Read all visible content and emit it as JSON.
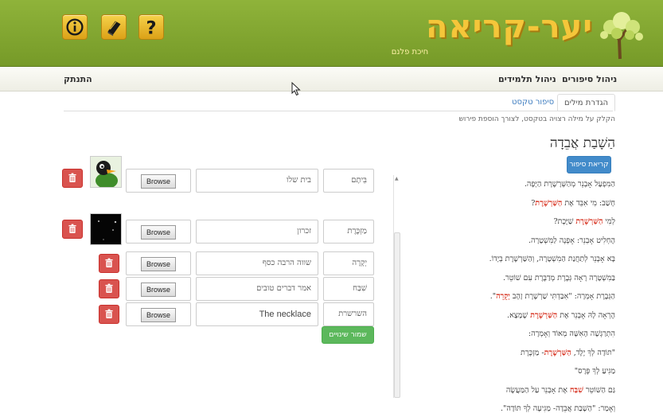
{
  "header": {
    "logo_title": "יער-קריאה",
    "logo_subtitle": "חיכת פלנם",
    "icons": [
      "info-icon",
      "book-icon",
      "help-icon"
    ],
    "brand_color": "#8fb33a"
  },
  "nav": {
    "manage_stories": "ניהול סיפורים",
    "manage_students": "ניהול תלמידים",
    "logout": "התנתק"
  },
  "tabs": {
    "word_settings": "הגדרת מילים",
    "story_text": "סיפור טקסט"
  },
  "hint": "הקלק על מילה רצויה בטקסט, לצורך הוספת פירוש",
  "story": {
    "title": "הַשָׁבַת אֲבֵדָה",
    "read_button": "קריאת סיפור",
    "lines": [
      {
        "pre": "הַמִּפְעָל אָבְנֵר מְהַשְּׁרָשֶׁרֶת הַיָּפָה.",
        "hl": "",
        "post": ""
      },
      {
        "pre": "חָשַׁב: מִי אִבֵּד אֶת ",
        "hl": "הַשַּׁרְשֶׁרֶת",
        "post": "?"
      },
      {
        "pre": "לְמִי ",
        "hl": "הַשַּׁרְשֶׁרֶת",
        "post": " שַׁיֶּכֶת?"
      },
      {
        "pre": "הֶחְלִיט אָבְנֵר: אָפְנֶה לַמִּשְׁטָרָה.",
        "hl": "",
        "post": ""
      },
      {
        "pre": "בָּא אָבְנֵר לְתַחֲנַת הַמִּשְׁטָרָה, וְהַשַּׁרְשֶׁרֶת בְּיָדוֹ.",
        "hl": "",
        "post": ""
      },
      {
        "pre": "בַּמִּשְׁטָרָה רָאָה גְּבֶרֶת מְדַבֶּרֶת עִם שׁוֹטֵר.",
        "hl": "",
        "post": ""
      },
      {
        "pre": "הַגְּבֶרֶת אָמְרָה: \"אִבַּדְתִּי שַׁרְשֶׁרֶת זָהָב ",
        "hl": "יְקָרָה",
        "post": "\"."
      },
      {
        "pre": "הֶרְאָה לָהּ אָבְנֵר אֶת ",
        "hl": "הַשַּׁרְשֶׁרֶת",
        "post": " שֶׁמָּצָא."
      },
      {
        "pre": "הִתְרַגְּשָׁה הָאִשָּׁה מְאוֹד וְאָמְרָה:",
        "hl": "",
        "post": ""
      },
      {
        "pre": "\"תּוֹדָה לְךָ יֶלֶד, ",
        "hl": "הַשַּׁרְשֶׁרֶת",
        "post": "- מַזְכֶּרֶת"
      },
      {
        "pre": "מַגִּיעַ לְךָ פְּרָס\"",
        "hl": "",
        "post": ""
      },
      {
        "pre": "גַּם הַשּׁוֹטֵר ",
        "hl": "שִׁבַּח",
        "post": " אֶת אָבְנֵר עַל הַמַּעֲשֶׂה"
      },
      {
        "pre": "וְאָמַר: \"הַשָׁבַת אֲבֵדָה- מַגִּיעָה לְךָ תּוֹדָה\".",
        "hl": "",
        "post": ""
      }
    ],
    "highlight_color": "#d62c1a"
  },
  "words": [
    {
      "word": "בֵּיתָם",
      "definition": "בית שלו",
      "file_button": "Browse",
      "has_image": true,
      "image": "duck-character-image"
    },
    {
      "word": "מַזְכֶּרֶת",
      "definition": "זכרון",
      "file_button": "Browse",
      "has_image": true,
      "image": "dark-image"
    },
    {
      "word": "יְקָרָה",
      "definition": "שווה הרבה כסף",
      "file_button": "Browse",
      "has_image": false
    },
    {
      "word": "שִׁבַּח",
      "definition": "אמר דברים טובים",
      "file_button": "Browse",
      "has_image": false
    },
    {
      "word": "השרשרת",
      "definition": "The necklace",
      "file_button": "Browse",
      "has_image": false
    }
  ],
  "save_button": "שמור שינויים"
}
